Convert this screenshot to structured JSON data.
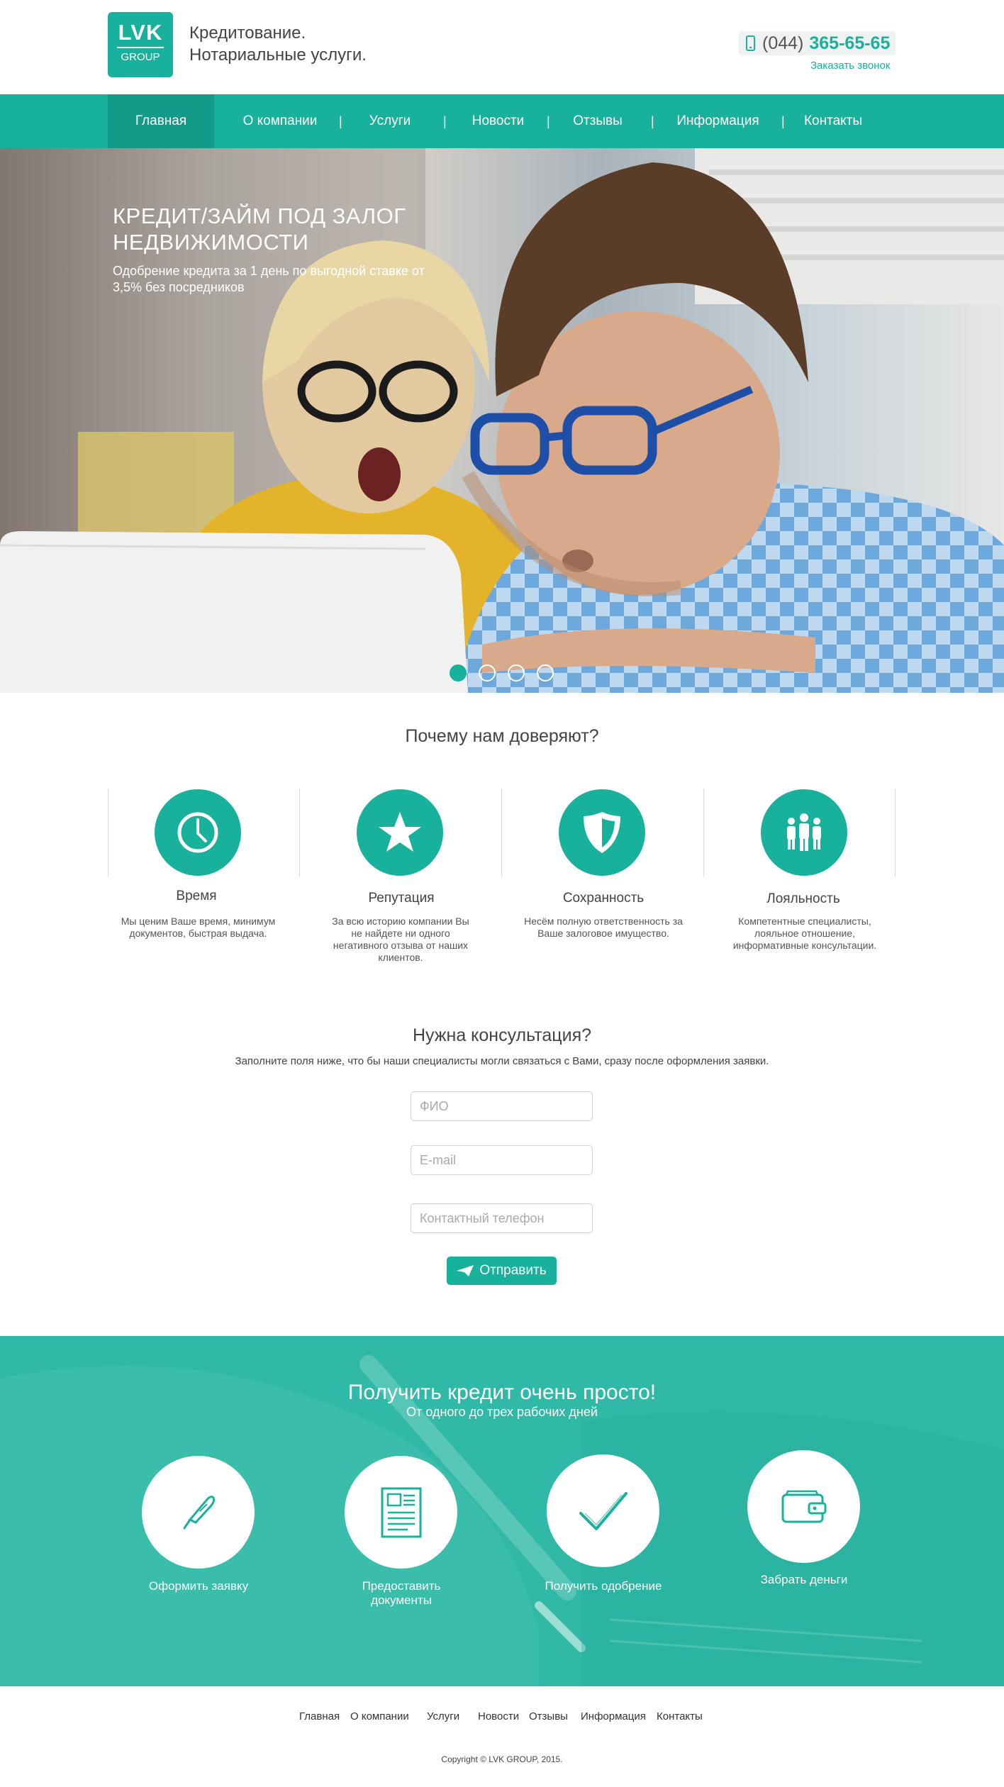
{
  "header": {
    "logo_top": "LVK",
    "logo_bottom": "GROUP",
    "tagline_1": "Кредитование.",
    "tagline_2": "Нотариальные услуги.",
    "phone_code": "(044)",
    "phone_number": "365-65-65",
    "callback_label": "Заказать звонок"
  },
  "nav": {
    "items": [
      {
        "label": "Главная",
        "active": true
      },
      {
        "label": "О компании"
      },
      {
        "label": "Услуги"
      },
      {
        "label": "Новости"
      },
      {
        "label": "Отзывы"
      },
      {
        "label": "Информация"
      },
      {
        "label": "Контакты"
      }
    ],
    "separator": "|"
  },
  "hero": {
    "title": "КРЕДИТ/ЗАЙМ ПОД ЗАЛОГ НЕДВИЖИМОСТИ",
    "subtitle": "Одобрение кредита за 1 день по выгодной ставке от 3,5% без посредников",
    "slides_count": 4,
    "active_slide": 1
  },
  "why": {
    "title": "Почему нам доверяют?",
    "features": [
      {
        "icon": "clock-icon",
        "title": "Время",
        "text": "Мы ценим Ваше время, минимум документов, быстрая выдача."
      },
      {
        "icon": "star-icon",
        "title": "Репутация",
        "text": "За всю историю компании Вы не найдете ни одного негативного отзыва от наших клиентов."
      },
      {
        "icon": "shield-icon",
        "title": "Сохранность",
        "text": "Несём полную ответственность за Ваше залоговое имущество."
      },
      {
        "icon": "people-icon",
        "title": "Лояльность",
        "text": "Компетентные специалисты, лояльное отношение, информативные консультации."
      }
    ]
  },
  "consult": {
    "title": "Нужна консультация?",
    "subtitle": "Заполните поля ниже, что бы наши специалисты могли связаться с Вами, сразу после оформления заявки.",
    "name_placeholder": "ФИО",
    "email_placeholder": "E-mail",
    "phone_placeholder": "Контактный телефон",
    "submit_label": "Отправить"
  },
  "steps": {
    "title": "Получить кредит очень просто!",
    "subtitle": "От одного до трех рабочих дней",
    "items": [
      {
        "icon": "pen-icon",
        "label": "Оформить заявку"
      },
      {
        "icon": "document-icon",
        "label": "Предоставить документы"
      },
      {
        "icon": "checkmark-icon",
        "label": "Получить одобрение"
      },
      {
        "icon": "wallet-icon",
        "label": "Забрать деньги"
      }
    ]
  },
  "footer": {
    "links": [
      "Главная",
      "О компании",
      "Услуги",
      "Новости",
      "Отзывы",
      "Информация",
      "Контакты"
    ],
    "copyright": "Copyright © LVK GROUP, 2015."
  },
  "colors": {
    "accent": "#17b19c",
    "accent_dark": "#139a88",
    "band": "#2fb9a6"
  }
}
